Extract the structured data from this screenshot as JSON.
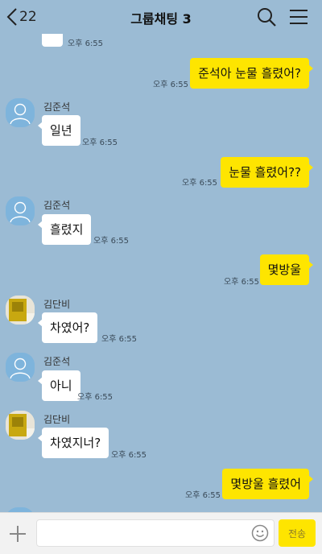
{
  "header": {
    "back_count": "22",
    "title": "그룹채팅 3"
  },
  "messages": [
    {
      "time": "오후 6:55"
    },
    {
      "text": "준석아 눈물 흘렸어?",
      "time": "오후 6:55"
    },
    {
      "sender": "김준석",
      "text": "일년",
      "time": "오후 6:55"
    },
    {
      "text": "눈물 흘렸어??",
      "time": "오후 6:55"
    },
    {
      "sender": "김준석",
      "text": "흘렸지",
      "time": "오후 6:55"
    },
    {
      "text": "몇방울",
      "time": "오후 6:55"
    },
    {
      "sender": "김단비",
      "text": "차였어?",
      "time": "오후 6:55"
    },
    {
      "sender": "김준석",
      "text": "아니",
      "time": "오후 6:55"
    },
    {
      "sender": "김단비",
      "text": "차였지너?",
      "time": "오후 6:55"
    },
    {
      "text": "몇방울 흘렸어",
      "time": "오후 6:55"
    }
  ],
  "composer": {
    "input_value": "",
    "send_label": "전송"
  },
  "colors": {
    "background": "#9bbbd4",
    "my_bubble": "#fee500",
    "their_bubble": "#ffffff"
  }
}
